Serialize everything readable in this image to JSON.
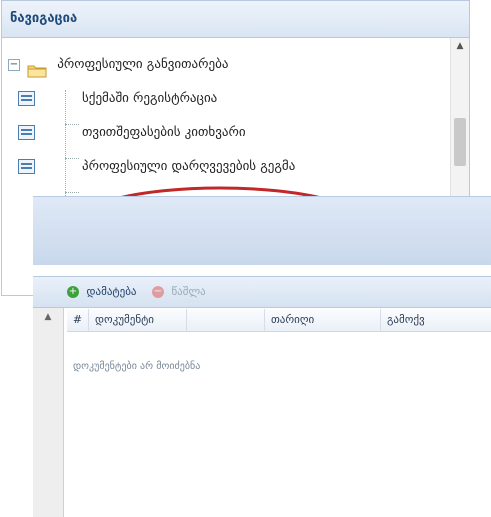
{
  "nav": {
    "title": "ნავიგაცია",
    "root_expander": "−",
    "root_label": "პროფესიული განვითარება",
    "items": [
      {
        "label": "სქემაში რეგისტრაცია"
      },
      {
        "label": "თვითშეფასების კითხვარი"
      },
      {
        "label": "პროფესიული დარღვევების გეგმა"
      }
    ],
    "scroll_up": "▲"
  },
  "grid": {
    "toolbar": {
      "add_label": "დამატება",
      "add_icon": "+",
      "delete_label": "წაშლა",
      "delete_icon": "−"
    },
    "columns": {
      "number": "#",
      "document": "დოკუმენტი",
      "blank": "",
      "date": "თარიღი",
      "more": "გამოქვ"
    },
    "empty_text": "დოკუმენტები არ მოიძებნა",
    "scroll_up": "▲"
  },
  "colors": {
    "accent": "#1f4a7a",
    "annotation": "#c0282a",
    "add": "#3da23d",
    "delete": "#e06060"
  }
}
